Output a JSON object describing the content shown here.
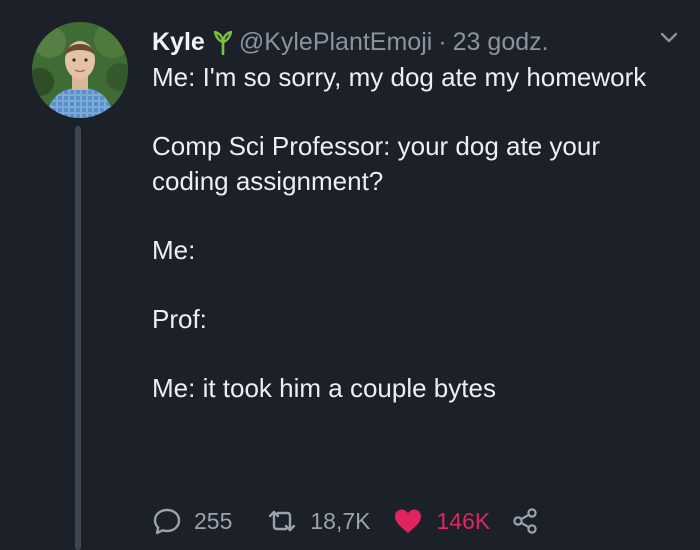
{
  "tweet": {
    "author_name": "Kyle",
    "author_handle": "@KylePlantEmoji",
    "separator": "·",
    "timestamp": "23 godz.",
    "lines": [
      "Me: I'm so sorry, my dog ate my homework",
      "Comp Sci Professor: your dog ate your coding assignment?",
      "Me:",
      "Prof:",
      "Me: it took him a couple bytes"
    ],
    "replies": "255",
    "retweets": "18,7K",
    "likes": "146K"
  },
  "colors": {
    "background": "#1b2029",
    "text": "#eceef1",
    "muted": "#8b949e",
    "like": "#e0245e",
    "plant_emoji": "#7bc142"
  },
  "icons": [
    "plant-icon",
    "chevron-down-icon",
    "reply-icon",
    "retweet-icon",
    "heart-icon",
    "share-icon"
  ]
}
